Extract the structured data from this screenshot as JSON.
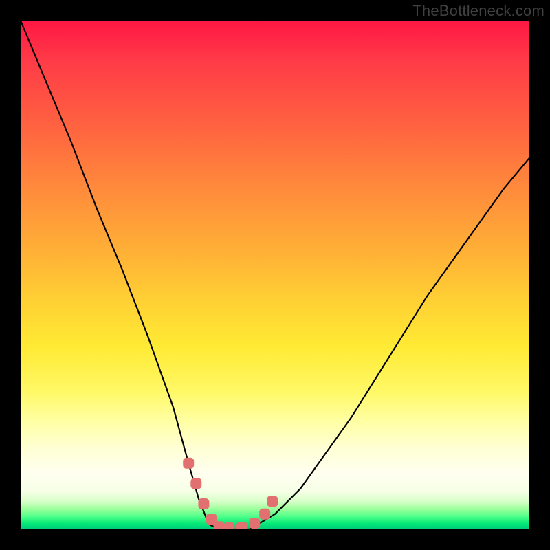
{
  "attribution": "TheBottleneck.com",
  "chart_data": {
    "type": "line",
    "title": "",
    "xlabel": "",
    "ylabel": "",
    "xlim": [
      0,
      100
    ],
    "ylim": [
      0,
      100
    ],
    "annotations": [],
    "series": [
      {
        "name": "bottleneck-curve",
        "x": [
          0,
          5,
          10,
          15,
          20,
          25,
          30,
          33,
          35,
          37,
          39,
          41,
          45,
          50,
          55,
          60,
          65,
          70,
          75,
          80,
          85,
          90,
          95,
          100
        ],
        "values": [
          100,
          88,
          76,
          63,
          51,
          38,
          24,
          13,
          6,
          1,
          0,
          0,
          0,
          3,
          8,
          15,
          22,
          30,
          38,
          46,
          53,
          60,
          67,
          73
        ]
      }
    ],
    "markers": {
      "name": "curve-near-bottom-markers",
      "color": "#e27070",
      "x": [
        33.0,
        34.5,
        36.0,
        37.5,
        39.0,
        41.0,
        43.5,
        46.0,
        48.0,
        49.5
      ],
      "values": [
        13.0,
        9.0,
        5.0,
        2.0,
        0.5,
        0.3,
        0.4,
        1.2,
        3.0,
        5.5
      ]
    },
    "background_gradient": [
      "#ff1744",
      "#ffea34",
      "#00c97a"
    ]
  }
}
